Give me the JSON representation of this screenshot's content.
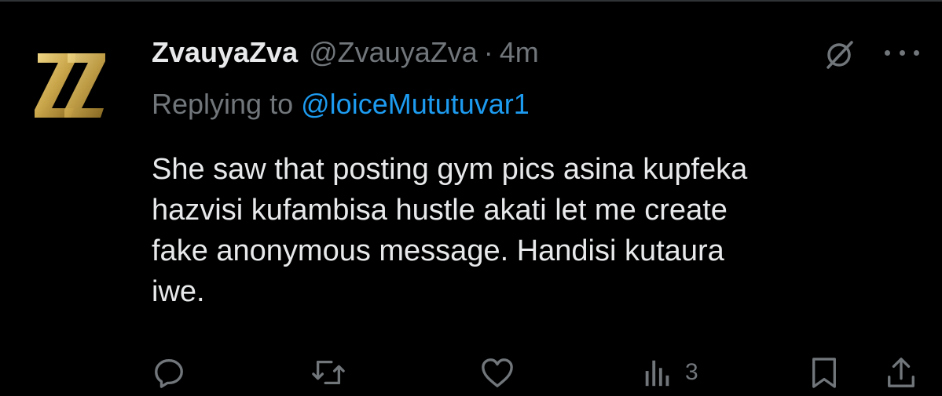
{
  "tweet": {
    "display_name": "ZvauyaZva",
    "handle": "@ZvauyaZva",
    "separator": "·",
    "time": "4m",
    "replying_label": "Replying to",
    "replying_to": "@loiceMututuvar1",
    "text_lines": [
      "She saw that posting gym pics asina kupfeka",
      "hazvisi kufambisa hustle akati let me create",
      "fake anonymous message. Handisi kutaura",
      "iwe."
    ],
    "avatar_icon": "zz-logo-icon",
    "header_icons": [
      "grok-icon",
      "more-icon"
    ]
  },
  "actions": {
    "reply_icon": "reply-icon",
    "retweet_icon": "retweet-icon",
    "like_icon": "heart-icon",
    "views_icon": "views-icon",
    "views_count": "3",
    "bookmark_icon": "bookmark-icon",
    "share_icon": "share-icon"
  },
  "colors": {
    "background": "#000000",
    "text": "#e7e9ea",
    "muted": "#71767b",
    "link": "#1d9bf0",
    "avatar_gold": "#c9a54a"
  }
}
